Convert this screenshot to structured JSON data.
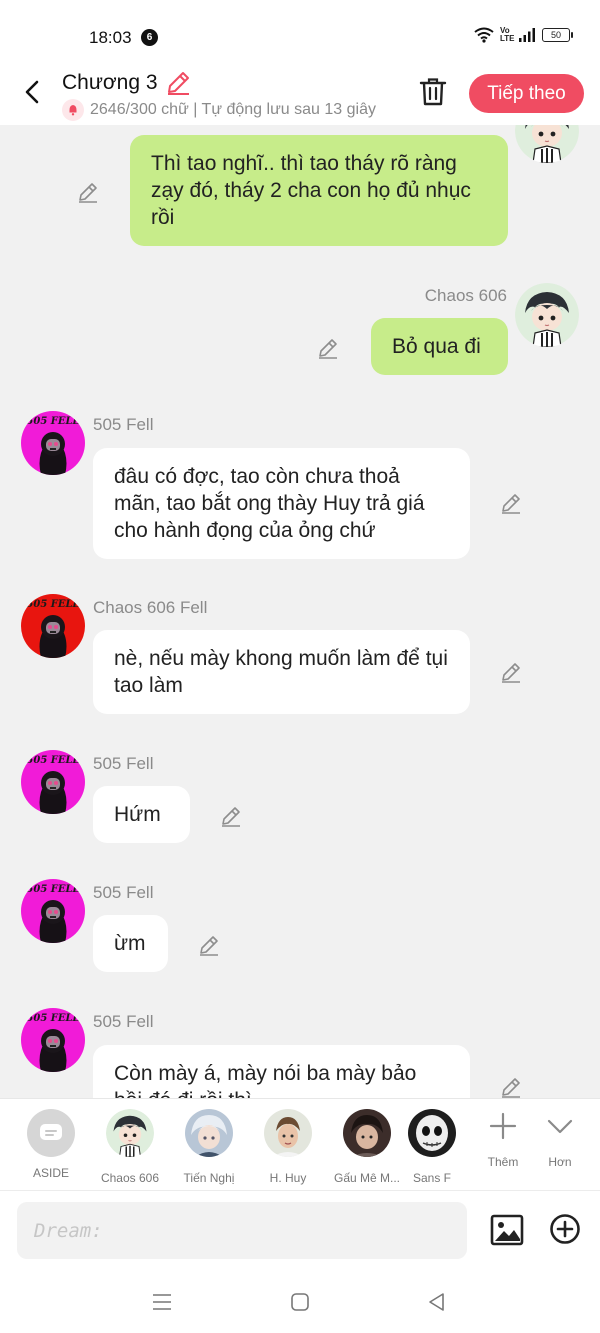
{
  "status_bar": {
    "time": "18:03",
    "notification_count": "6",
    "network": "Vo LTE",
    "battery": "50"
  },
  "header": {
    "title": "Chương 3",
    "status": "2646/300 chữ | Tự động lưu sau 13 giây",
    "next_label": "Tiếp theo"
  },
  "messages": [
    {
      "side": "mine",
      "text": "Thì tao nghĩ.. thì tao tháy rõ ràng zạy đó, tháy 2 cha con họ đủ nhục rồi"
    },
    {
      "side": "mine",
      "sender": "Chaos 606",
      "text": "Bỏ qua đi"
    },
    {
      "side": "theirs",
      "sender": "505 Fell",
      "text": "đâu có đợc, tao còn chưa thoả mãn, tao bắt ong thày Huy trả giá cho hành đọng của ỏng chứ"
    },
    {
      "side": "theirs",
      "sender": "Chaos 606 Fell",
      "text": "nè, nếu mày khong muốn làm để tụi tao làm"
    },
    {
      "side": "theirs",
      "sender": "505 Fell",
      "text": "Hứm"
    },
    {
      "side": "theirs",
      "sender": "505 Fell",
      "text": "ừm"
    },
    {
      "side": "theirs",
      "sender": "505 Fell",
      "text": "Còn mày á, mày nói ba mày bảo hồi đó đi rồi thì"
    }
  ],
  "avatar_text": "505 FELL",
  "characters": [
    {
      "name": "ASIDE"
    },
    {
      "name": "Chaos 606"
    },
    {
      "name": "Tiến Nghị"
    },
    {
      "name": "H. Huy"
    },
    {
      "name": "Gấu Mê M..."
    },
    {
      "name": "Sans F"
    }
  ],
  "tools": {
    "add_label": "Thêm",
    "more_label": "Hơn"
  },
  "input": {
    "placeholder": "Dream:"
  },
  "colors": {
    "accent": "#f04c62",
    "my_bubble": "#c7ec8a",
    "their_bubble": "#ffffff",
    "chat_background": "#f1f1f1",
    "avatar_magenta": "#f11bd8",
    "avatar_red": "#e8150f"
  },
  "icons": {
    "back": "chevron-left-icon",
    "title_edit": "pencil-icon",
    "delete": "trash-icon",
    "message_edit": "pencil-icon",
    "image": "image-icon",
    "add": "plus-circle-icon"
  }
}
